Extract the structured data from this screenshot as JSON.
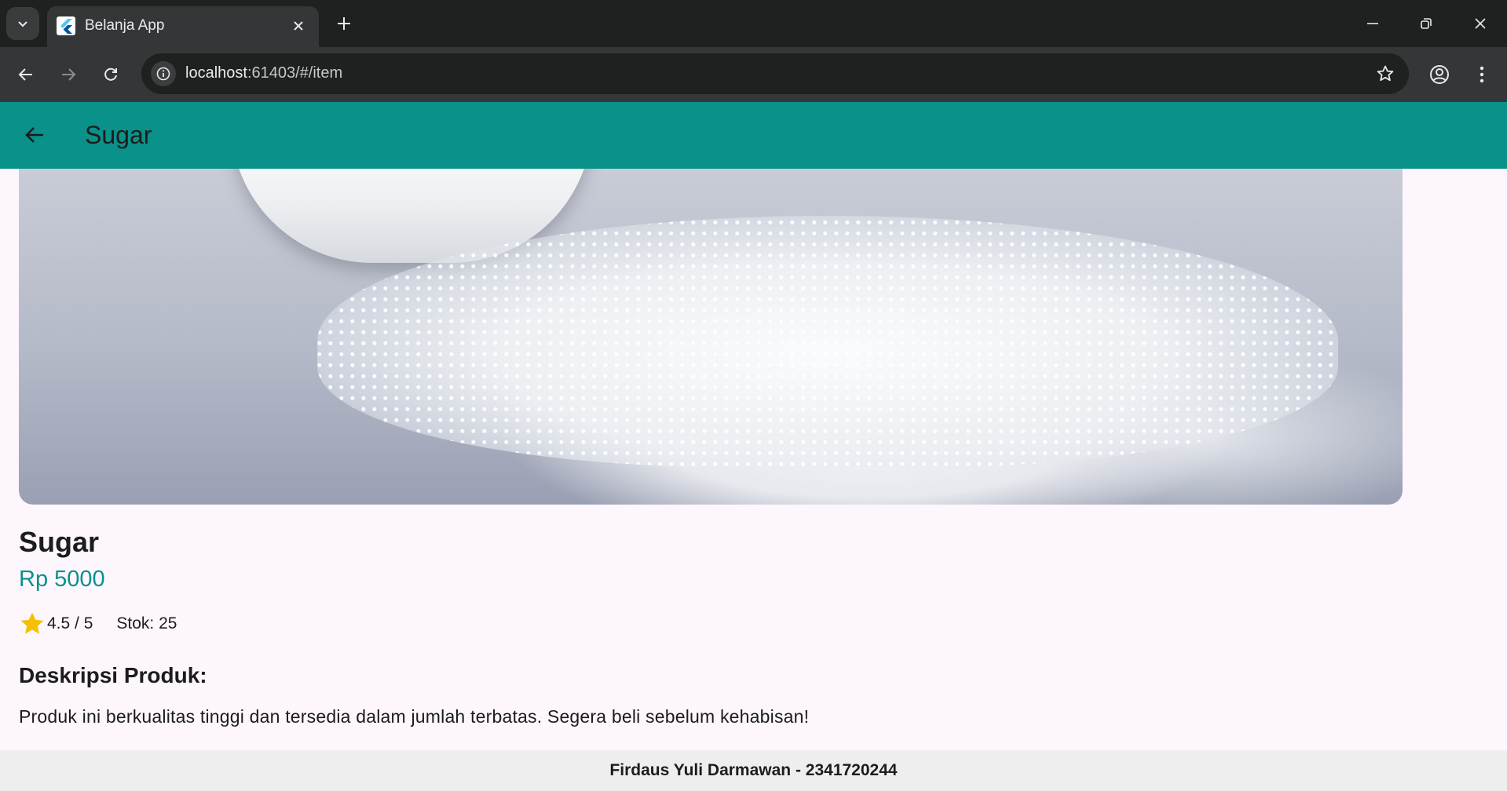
{
  "browser": {
    "tab_title": "Belanja App",
    "url_host": "localhost",
    "url_path": ":61403/#/item",
    "icons": {
      "tab_list": "chevron-down-icon",
      "close_tab": "close-icon",
      "new_tab": "plus-icon",
      "minimize": "minimize-icon",
      "restore": "restore-icon",
      "close_window": "close-icon",
      "back": "arrow-left-icon",
      "forward": "arrow-right-icon",
      "reload": "reload-icon",
      "site_info": "info-icon",
      "bookmark": "star-outline-icon",
      "profile": "account-icon",
      "menu": "kebab-menu-icon"
    }
  },
  "app": {
    "appbar": {
      "title": "Sugar",
      "color": "#0a918a"
    },
    "product": {
      "name": "Sugar",
      "price": "Rp 5000",
      "rating": "4.5 / 5",
      "stock": "Stok: 25",
      "description_title": "Deskripsi Produk:",
      "description": "Produk ini berkualitas tinggi dan tersedia dalam jumlah terbatas. Segera beli sebelum kehabisan!"
    },
    "footer": {
      "text": "Firdaus Yuli Darmawan - 2341720244"
    },
    "colors": {
      "accent": "#0a918a",
      "star": "#f5c000",
      "background": "#fdf7fd"
    }
  }
}
